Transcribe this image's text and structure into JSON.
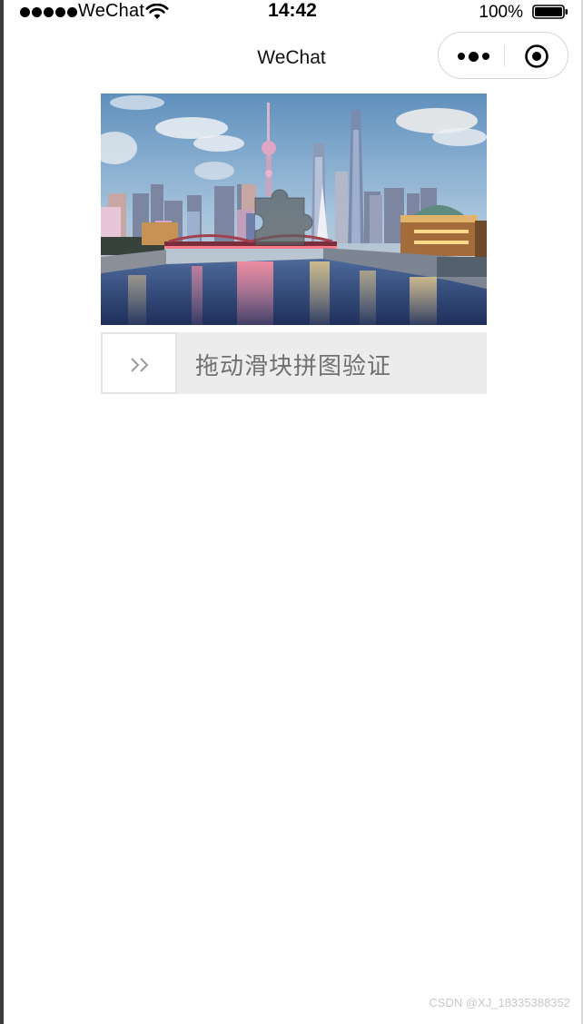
{
  "status_bar": {
    "carrier": "WeChat",
    "time": "14:42",
    "battery_percent": "100%"
  },
  "nav": {
    "title": "WeChat"
  },
  "icons": {
    "signal": "signal-dots-icon",
    "wifi": "wifi-icon",
    "battery": "battery-icon",
    "more": "more-dots-icon",
    "close": "target-close-icon",
    "slider": "double-chevron-right-icon"
  },
  "puzzle": {
    "image_description": "Shanghai skyline at dusk over the river"
  },
  "slider": {
    "label": "拖动滑块拼图验证"
  },
  "watermark": "CSDN @XJ_18335388352"
}
